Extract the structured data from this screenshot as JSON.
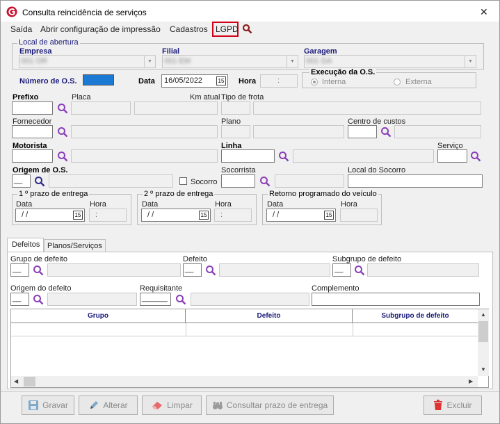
{
  "window": {
    "title": "Consulta reincidência de serviços",
    "close": "✕"
  },
  "menu": {
    "sair": "Saída",
    "abrir": "Abrir configuração de impressão",
    "cadastros": "Cadastros",
    "lgpd": "LGPD"
  },
  "local": {
    "legend": "Local de abertura",
    "empresa_label": "Empresa",
    "empresa_value": "001 OR",
    "filial_label": "Filial",
    "filial_value": "001 EM",
    "garagem_label": "Garagem",
    "garagem_value": "001 GA"
  },
  "os": {
    "numero_label": "Número de O.S.",
    "data_label": "Data",
    "data_value": "16/05/2022",
    "hora_label": "Hora",
    "hora_value": ":"
  },
  "execucao": {
    "legend": "Execução da O.S.",
    "interna": "Interna",
    "externa": "Externa"
  },
  "fields": {
    "prefixo": "Prefixo",
    "placa": "Placa",
    "km_atual": "Km atual",
    "tipo_frota": "Tipo de frota",
    "fornecedor": "Fornecedor",
    "plano": "Plano",
    "centro_custos": "Centro de custos",
    "motorista": "Motorista",
    "linha": "Linha",
    "servico": "Serviço",
    "origem_os": "Origem de O.S.",
    "origem_os_value": "__",
    "socorro": "Socorro",
    "socorrista": "Socorrista",
    "local_socorro": "Local do Socorro"
  },
  "prazos": [
    {
      "legend": "1 º prazo de entrega",
      "data_label": "Data",
      "data_value": "/ /",
      "hora_label": "Hora",
      "hora_value": ":"
    },
    {
      "legend": "2 º prazo de entrega",
      "data_label": "Data",
      "data_value": "/ /",
      "hora_label": "Hora",
      "hora_value": ":"
    },
    {
      "legend": "Retorno programado do veículo",
      "data_label": "Data",
      "data_value": "/ /",
      "hora_label": "Hora",
      "hora_value": ""
    }
  ],
  "tabs": [
    {
      "label": "Defeitos"
    },
    {
      "label": "Planos/Serviços"
    }
  ],
  "defeitos": {
    "grupo": "Grupo de defeito",
    "defeito": "Defeito",
    "subgrupo": "Subgrupo de defeito",
    "origem": "Origem do defeito",
    "requisitante": "Requisitante",
    "complemento": "Complemento",
    "blank_short": "__",
    "blank_long": "______"
  },
  "grid": {
    "columns": [
      "Grupo",
      "Defeito",
      "Subgrupo de defeito"
    ]
  },
  "buttons": {
    "gravar": "Gravar",
    "alterar": "Alterar",
    "limpar": "Limpar",
    "consultar": "Consultar prazo de entrega",
    "excluir": "Excluir"
  },
  "colors": {
    "accent_red": "#d0021b",
    "magnifier": "#8a3fb8",
    "highlight": "#1a7ad4"
  }
}
